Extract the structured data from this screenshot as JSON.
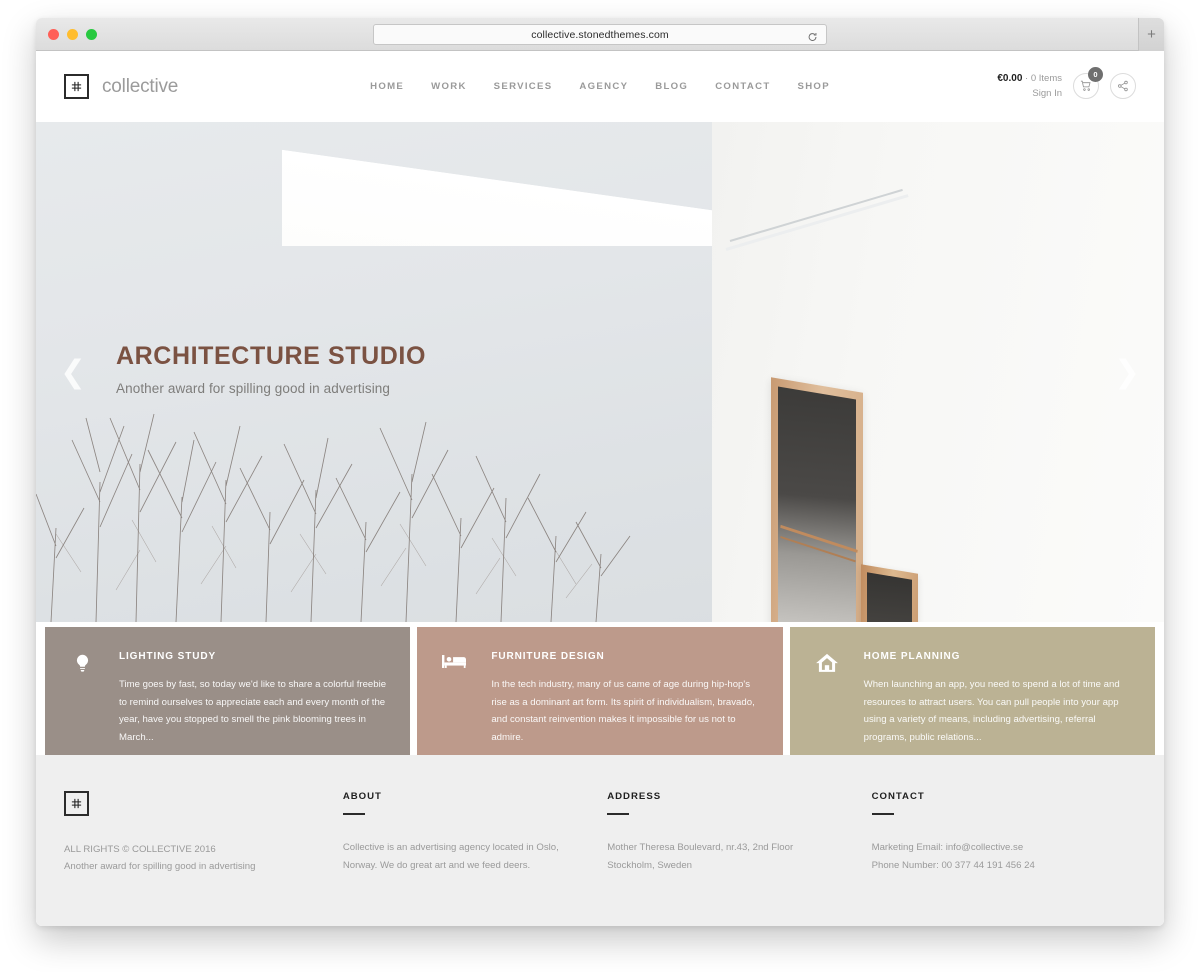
{
  "browser": {
    "url": "collective.stonedthemes.com",
    "reload_icon": "reload-icon",
    "newtab_label": "+"
  },
  "header": {
    "logo_icon": "grid-hash-logo-icon",
    "brand": "collective",
    "nav": [
      {
        "label": "HOME"
      },
      {
        "label": "WORK"
      },
      {
        "label": "SERVICES"
      },
      {
        "label": "AGENCY"
      },
      {
        "label": "BLOG"
      },
      {
        "label": "CONTACT"
      },
      {
        "label": "SHOP"
      }
    ],
    "cart": {
      "price": "€0.00",
      "items": "· 0 Items",
      "signin": "Sign In",
      "badge": "0",
      "cart_icon": "shopping-cart-icon",
      "share_icon": "share-icon"
    }
  },
  "hero": {
    "title": "ARCHITECTURE STUDIO",
    "subtitle": "Another award for spilling good in advertising",
    "prev_icon": "chevron-left-icon",
    "next_icon": "chevron-right-icon",
    "prev_glyph": "❮",
    "next_glyph": "❯",
    "title_color": "#7b5242"
  },
  "features": [
    {
      "icon": "lightbulb-icon",
      "title": "LIGHTING STUDY",
      "text": "Time goes by fast, so today we'd like to share a colorful freebie to remind ourselves to appreciate each and every month of the year, have you stopped to smell the pink blooming trees in March...",
      "color": "#9a8f88"
    },
    {
      "icon": "bed-icon",
      "title": "FURNITURE DESIGN",
      "text": "In the tech industry, many of us came of age during hip-hop's rise as a dominant art form. Its spirit of individualism, bravado, and constant reinvention makes it impossible for us not to admire.",
      "color": "#bd9a8b"
    },
    {
      "icon": "home-icon",
      "title": "HOME PLANNING",
      "text": "When launching an app, you need to spend a lot of time and resources to attract users. You can pull people into your app using a variety of means, including advertising, referral programs, public relations...",
      "color": "#bbb294"
    }
  ],
  "footer": {
    "logo_icon": "grid-hash-logo-icon",
    "copyright": "ALL RIGHTS © COLLECTIVE 2016",
    "tagline": "Another award for spilling good in advertising",
    "columns": [
      {
        "heading": "ABOUT",
        "text": "Collective is an advertising agency located in Oslo, Norway. We do great art and we feed deers."
      },
      {
        "heading": "ADDRESS",
        "text": "Mother Theresa Boulevard, nr.43, 2nd Floor Stockholm, Sweden"
      },
      {
        "heading": "CONTACT",
        "text": "Marketing Email: info@collective.se Phone Number: 00 377 44 191 456 24"
      }
    ],
    "address_line1": "Mother Theresa Boulevard, nr.43, 2nd Floor",
    "address_line2": "Stockholm, Sweden",
    "contact_line1": "Marketing Email: info@collective.se",
    "contact_line2": "Phone Number: 00 377 44 191 456 24"
  }
}
